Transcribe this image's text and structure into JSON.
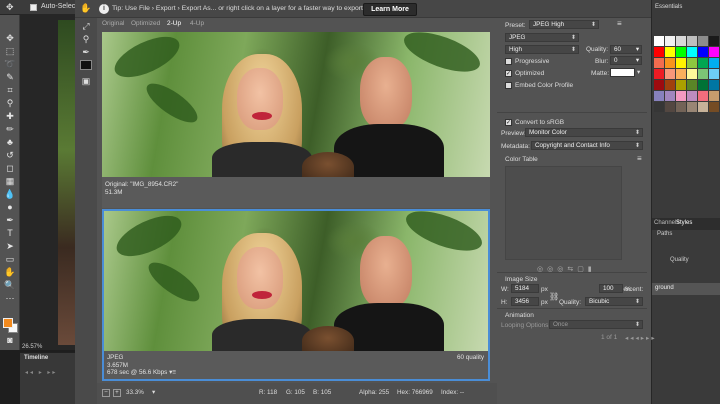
{
  "photoshop": {
    "options": {
      "auto_select_label": "Auto-Select:"
    },
    "zoom": "26.57%",
    "timeline_title": "Timeline",
    "essentials_label": "Essentials",
    "panel_tabs": [
      "Channels",
      "Styles"
    ],
    "paths_label": "Paths",
    "quality_stub": "Quality",
    "layer_name": "ground",
    "swatch_colors": [
      "#ffffff",
      "#f2f2f2",
      "#d9d9d9",
      "#bfbfbf",
      "#8c8c8c",
      "#1a1a1a",
      "#ff0000",
      "#ffff00",
      "#00ff00",
      "#00ffff",
      "#0000ff",
      "#ff00ff",
      "#f26c4f",
      "#f7941d",
      "#fff200",
      "#8dc63f",
      "#00a651",
      "#00aeef",
      "#ed1c24",
      "#f7977a",
      "#fbaf5d",
      "#fff79a",
      "#7cc576",
      "#6dcff6",
      "#9e0b0f",
      "#a0410d",
      "#aba000",
      "#598527",
      "#007236",
      "#0076a3",
      "#8781bd",
      "#a186be",
      "#f49ac1",
      "#bd8cbf",
      "#f26d7d",
      "#c69c6d",
      "#363636",
      "#534741",
      "#736357",
      "#998675",
      "#c7b299",
      "#754c24"
    ]
  },
  "dialog": {
    "tip_text": "Tip: Use File › Export › Export As... or right click on a layer for a faster way to export assets",
    "learn_more": "Learn More",
    "view_tabs": [
      "Original",
      "Optimized",
      "2-Up",
      "4-Up"
    ],
    "active_tab": "2-Up",
    "original_pane": {
      "line1": "Original: \"IMG_8954.CR2\"",
      "line2": "51.3M"
    },
    "optimized_pane": {
      "line1": "JPEG",
      "line2": "3.657M",
      "line3": "678 sec @ 56.6 Kbps",
      "quality": "60 quality"
    },
    "bottom": {
      "zoom": "33.3%",
      "r": "R: 118",
      "g": "G: 105",
      "b": "B: 105",
      "alpha": "Alpha: 255",
      "hex": "Hex: 766969",
      "index": "Index: --"
    },
    "settings": {
      "preset_label": "Preset:",
      "preset_value": "JPEG High",
      "format": "JPEG",
      "compression": "High",
      "quality_label": "Quality:",
      "quality_value": "60",
      "progressive_label": "Progressive",
      "progressive_checked": false,
      "blur_label": "Blur:",
      "blur_value": "0",
      "optimized_label": "Optimized",
      "optimized_checked": true,
      "matte_label": "Matte:",
      "embed_label": "Embed Color Profile",
      "embed_checked": false,
      "srgb_label": "Convert to sRGB",
      "srgb_checked": true,
      "preview_label": "Preview:",
      "preview_value": "Monitor Color",
      "metadata_label": "Metadata:",
      "metadata_value": "Copyright and Contact Info",
      "color_table_label": "Color Table",
      "image_size_label": "Image Size",
      "w_label": "W:",
      "w_value": "5184",
      "h_label": "H:",
      "h_value": "3456",
      "px": "px",
      "percent_label": "Percent:",
      "percent_value": "100",
      "percent_unit": "%",
      "quality2_label": "Quality:",
      "quality2_value": "Bicubic",
      "animation_label": "Animation",
      "looping_label": "Looping Options:",
      "looping_value": "Once",
      "frame_count": "1 of 1"
    }
  }
}
